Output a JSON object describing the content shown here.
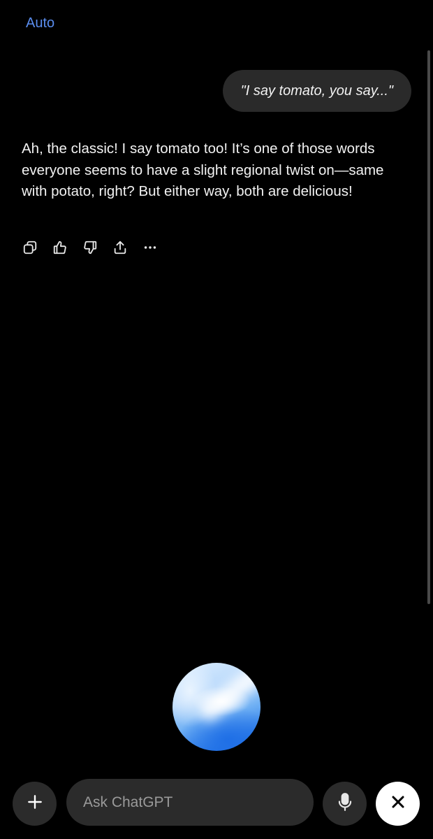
{
  "header": {
    "mode_label": "Auto"
  },
  "conversation": {
    "user_message": "\"I say tomato, you say...\"",
    "assistant_message": "Ah, the classic! I say tomato too! It’s one of those words everyone seems to have a slight regional twist on—same with potato, right? But either way, both are delicious!"
  },
  "message_actions": [
    {
      "icon": "copy-icon"
    },
    {
      "icon": "thumbs-up-icon"
    },
    {
      "icon": "thumbs-down-icon"
    },
    {
      "icon": "share-icon"
    },
    {
      "icon": "more-icon"
    }
  ],
  "composer": {
    "placeholder": "Ask ChatGPT",
    "value": "",
    "buttons": {
      "attach": "plus-icon",
      "voice": "microphone-icon",
      "close": "close-icon"
    }
  },
  "colors": {
    "background": "#000000",
    "accent": "#5a8dee",
    "bubble": "#2a2a2a",
    "control": "#2b2b2b"
  }
}
